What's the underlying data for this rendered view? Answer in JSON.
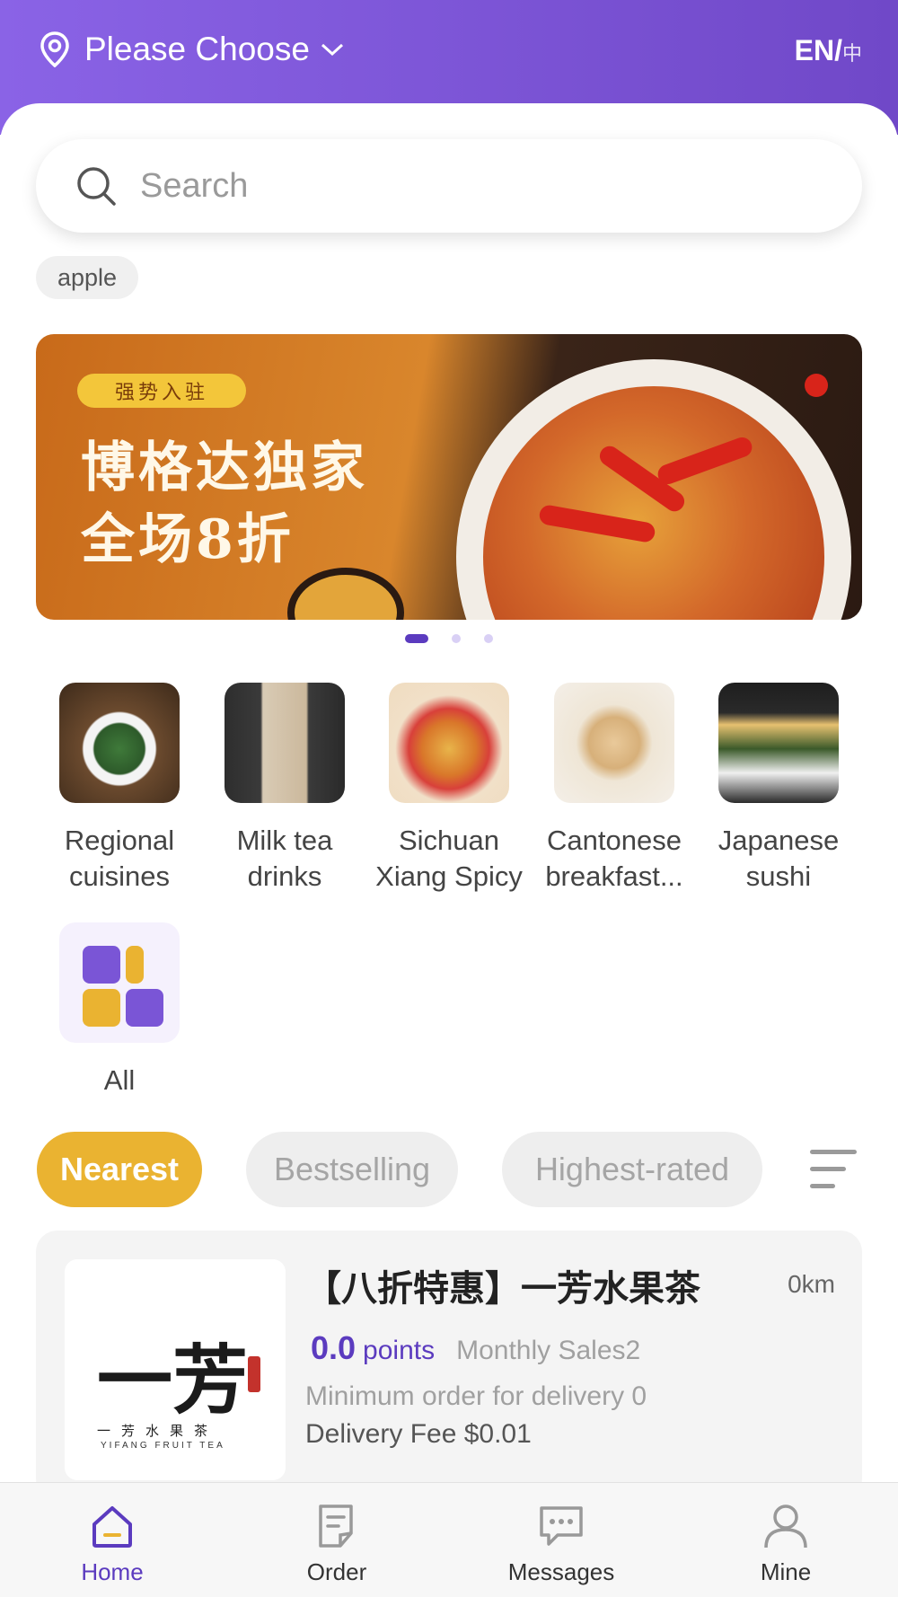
{
  "header": {
    "location_label": "Please Choose",
    "lang_primary": "EN/",
    "lang_secondary": "中"
  },
  "search": {
    "placeholder": "Search",
    "history_chip": "apple"
  },
  "banner": {
    "tag": "强势入驻",
    "line1": "博格达独家",
    "line2": "全场8折",
    "dots_count": 3,
    "active_dot": 0
  },
  "categories": [
    {
      "label": "Regional\ncuisines",
      "icon": "regional-cuisines-image"
    },
    {
      "label": "Milk tea\ndrinks",
      "icon": "milk-tea-image"
    },
    {
      "label": "Sichuan\nXiang Spicy",
      "icon": "sichuan-spicy-image"
    },
    {
      "label": "Cantonese\nbreakfast...",
      "icon": "cantonese-breakfast-image"
    },
    {
      "label": "Japanese\nsushi",
      "icon": "japanese-sushi-image"
    },
    {
      "label": "All",
      "icon": "grid-icon"
    }
  ],
  "filters": {
    "items": [
      "Nearest",
      "Bestselling",
      "Highest-rated"
    ],
    "active": "Nearest",
    "active_color": "#eab331"
  },
  "shop": {
    "name": "【八折特惠】一芳水果茶",
    "distance": "0km",
    "rating": "0.0",
    "rating_unit": "points",
    "monthly_sales": "Monthly Sales2",
    "min_order": "Minimum order for delivery 0",
    "delivery_fee": "Delivery Fee $0.01",
    "logo_text": "一芳",
    "logo_sub": "一芳水果茶",
    "logo_en": "YIFANG FRUIT TEA"
  },
  "tabbar": {
    "items": [
      {
        "label": "Home",
        "icon": "home-icon"
      },
      {
        "label": "Order",
        "icon": "order-icon"
      },
      {
        "label": "Messages",
        "icon": "messages-icon"
      },
      {
        "label": "Mine",
        "icon": "user-icon"
      }
    ],
    "active": "Home"
  },
  "colors": {
    "brand_purple": "#5b3bbf",
    "header_gradient_start": "#8a63e6",
    "accent_yellow": "#eab331"
  }
}
